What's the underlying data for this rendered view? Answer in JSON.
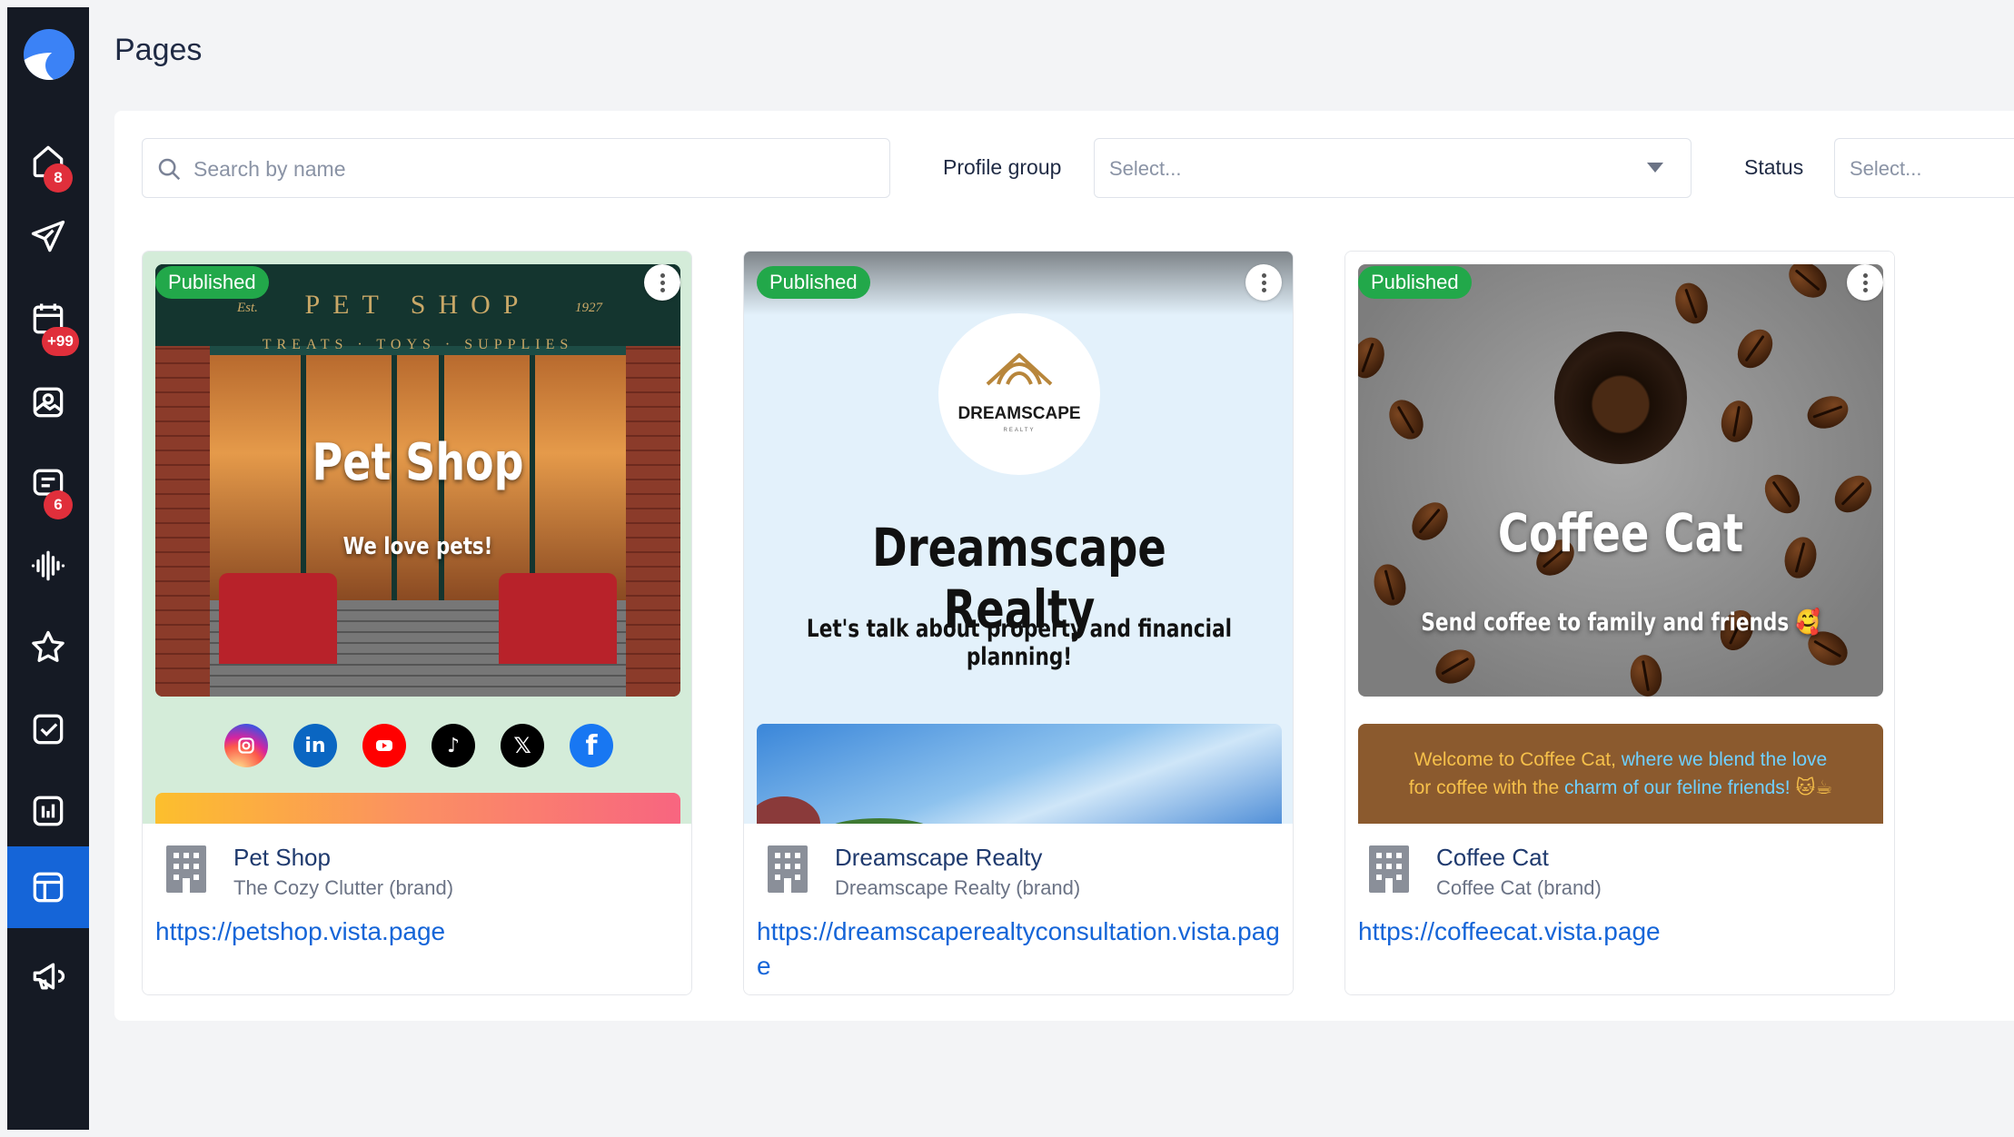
{
  "page": {
    "title": "Pages"
  },
  "filters": {
    "search_placeholder": "Search by name",
    "profile_group_label": "Profile group",
    "profile_group_placeholder": "Select...",
    "status_label": "Status",
    "status_placeholder": "Select..."
  },
  "sidebar": {
    "badges": {
      "home": "8",
      "calendar": "+99",
      "messages": "6"
    },
    "active_item": "pages",
    "accent_color": "#1565d8"
  },
  "cards": [
    {
      "status": "Published",
      "title": "Pet Shop",
      "brand": "The Cozy Clutter (brand)",
      "url": "https://petshop.vista.page",
      "preview": {
        "sign_main": "PET SHOP",
        "sign_year_left": "Est.",
        "sign_year_right": "1927",
        "sign_sub": "TREATS · TOYS · SUPPLIES",
        "headline": "Pet Shop",
        "subheadline": "We love pets!",
        "socials": [
          "instagram-icon",
          "linkedin-icon",
          "youtube-icon",
          "tiktok-icon",
          "x-icon",
          "facebook-icon"
        ]
      }
    },
    {
      "status": "Published",
      "title": "Dreamscape Realty",
      "brand": "Dreamscape Realty (brand)",
      "url": "https://dreamscaperealtyconsultation.vista.page",
      "preview": {
        "logo_word": "DREAMSCAPE",
        "logo_tagline": "REALTY",
        "headline": "Dreamscape Realty",
        "subheadline": "Let's talk about property and financial planning!"
      }
    },
    {
      "status": "Published",
      "title": "Coffee Cat",
      "brand": "Coffee Cat (brand)",
      "url": "https://coffeecat.vista.page",
      "preview": {
        "headline": "Coffee Cat",
        "subheadline": "Send coffee to family and friends 🥰",
        "welcome_part1": "Welcome to Coffee Cat, ",
        "welcome_part2": "where we blend the love",
        "welcome_part3": "for coffee with the ",
        "welcome_part4": "charm of our feline friends!",
        "welcome_emoji": " 🐱☕"
      }
    }
  ],
  "colors": {
    "published": "#22a84a",
    "link": "#1565d8",
    "sidebar": "#151a24"
  }
}
